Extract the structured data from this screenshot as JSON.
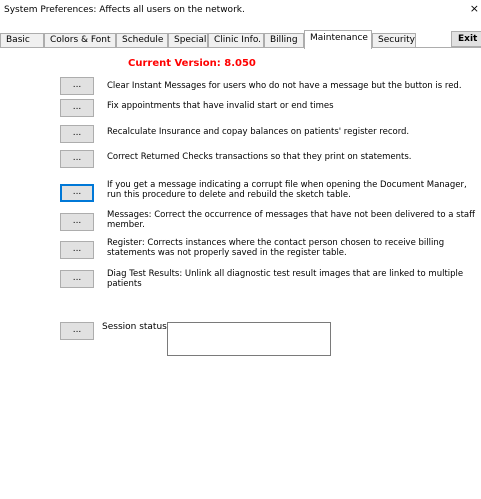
{
  "window": {
    "title": "System Preferences: Affects all users on the network.",
    "close_glyph": "×"
  },
  "tabs": [
    {
      "label": "Basic",
      "active": false
    },
    {
      "label": "Colors & Font",
      "active": false
    },
    {
      "label": "Schedule",
      "active": false
    },
    {
      "label": "Special",
      "active": false
    },
    {
      "label": "Clinic Info.",
      "active": false
    },
    {
      "label": "Billing",
      "active": false
    },
    {
      "label": "Maintenance",
      "active": true
    },
    {
      "label": "Security",
      "active": false
    }
  ],
  "exit_label": "Exit",
  "version_text": "Current Version: 8.050",
  "button_label": "...",
  "tasks": [
    {
      "text": "Clear Instant Messages for users who do not have a message but the button is red."
    },
    {
      "text": "Fix appointments that have invalid start or end times"
    },
    {
      "text": "Recalculate Insurance and copay balances on patients' register record."
    },
    {
      "text": "Correct Returned Checks transactions so that they print on statements."
    },
    {
      "text": "If you get a message indicating a corrupt file when opening the Document Manager, run this procedure to delete and rebuild the sketch table."
    },
    {
      "text": "Messages: Correct the occurrence of messages that have not been delivered to a staff member."
    },
    {
      "text": "Register: Corrects instances where the contact person chosen to receive billing statements was not properly saved in the register table."
    },
    {
      "text": "Diag Test Results: Unlink all diagnostic test result images that are linked to multiple patients"
    }
  ],
  "session": {
    "label": "Session status:",
    "value": ""
  }
}
